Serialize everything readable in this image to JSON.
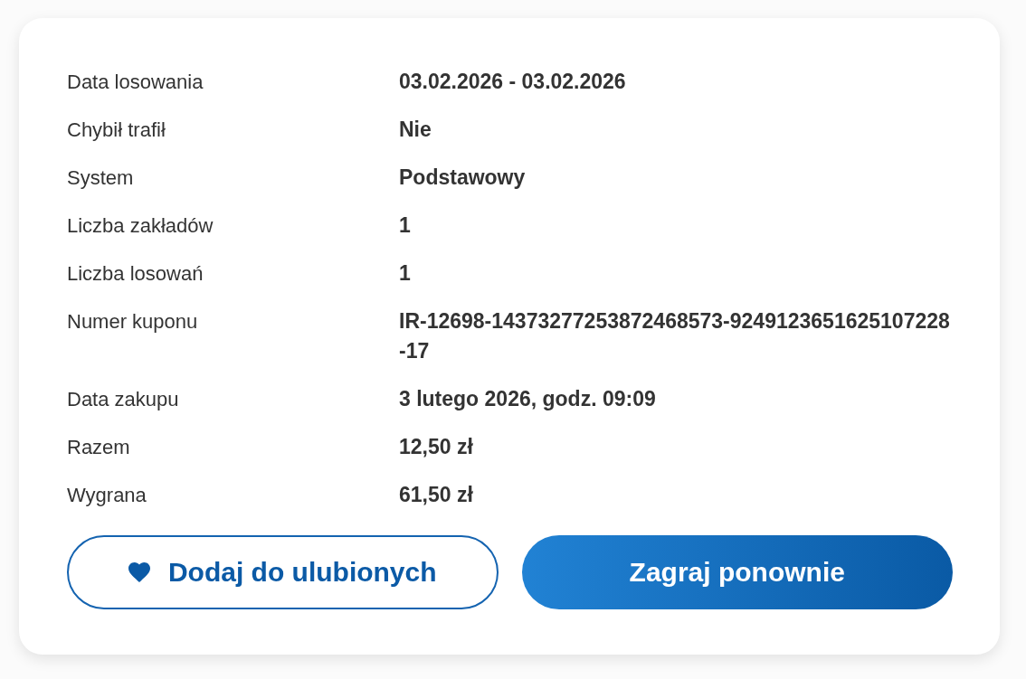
{
  "details": [
    {
      "label": "Data losowania",
      "value": "03.02.2026 - 03.02.2026"
    },
    {
      "label": "Chybił trafił",
      "value": "Nie"
    },
    {
      "label": "System",
      "value": "Podstawowy"
    },
    {
      "label": "Liczba zakładów",
      "value": "1"
    },
    {
      "label": "Liczba losowań",
      "value": "1"
    },
    {
      "label": "Numer kuponu",
      "value": "IR-12698-14373277253872468573-9249123651625107228-17"
    },
    {
      "label": "Data zakupu",
      "value": "3 lutego 2026, godz. 09:09"
    },
    {
      "label": "Razem",
      "value": "12,50 zł"
    },
    {
      "label": "Wygrana",
      "value": "61,50 zł"
    }
  ],
  "actions": [
    {
      "kind": "favorite",
      "label": "Dodaj do ulubionych"
    },
    {
      "kind": "primary",
      "label": "Zagraj ponownie"
    }
  ]
}
